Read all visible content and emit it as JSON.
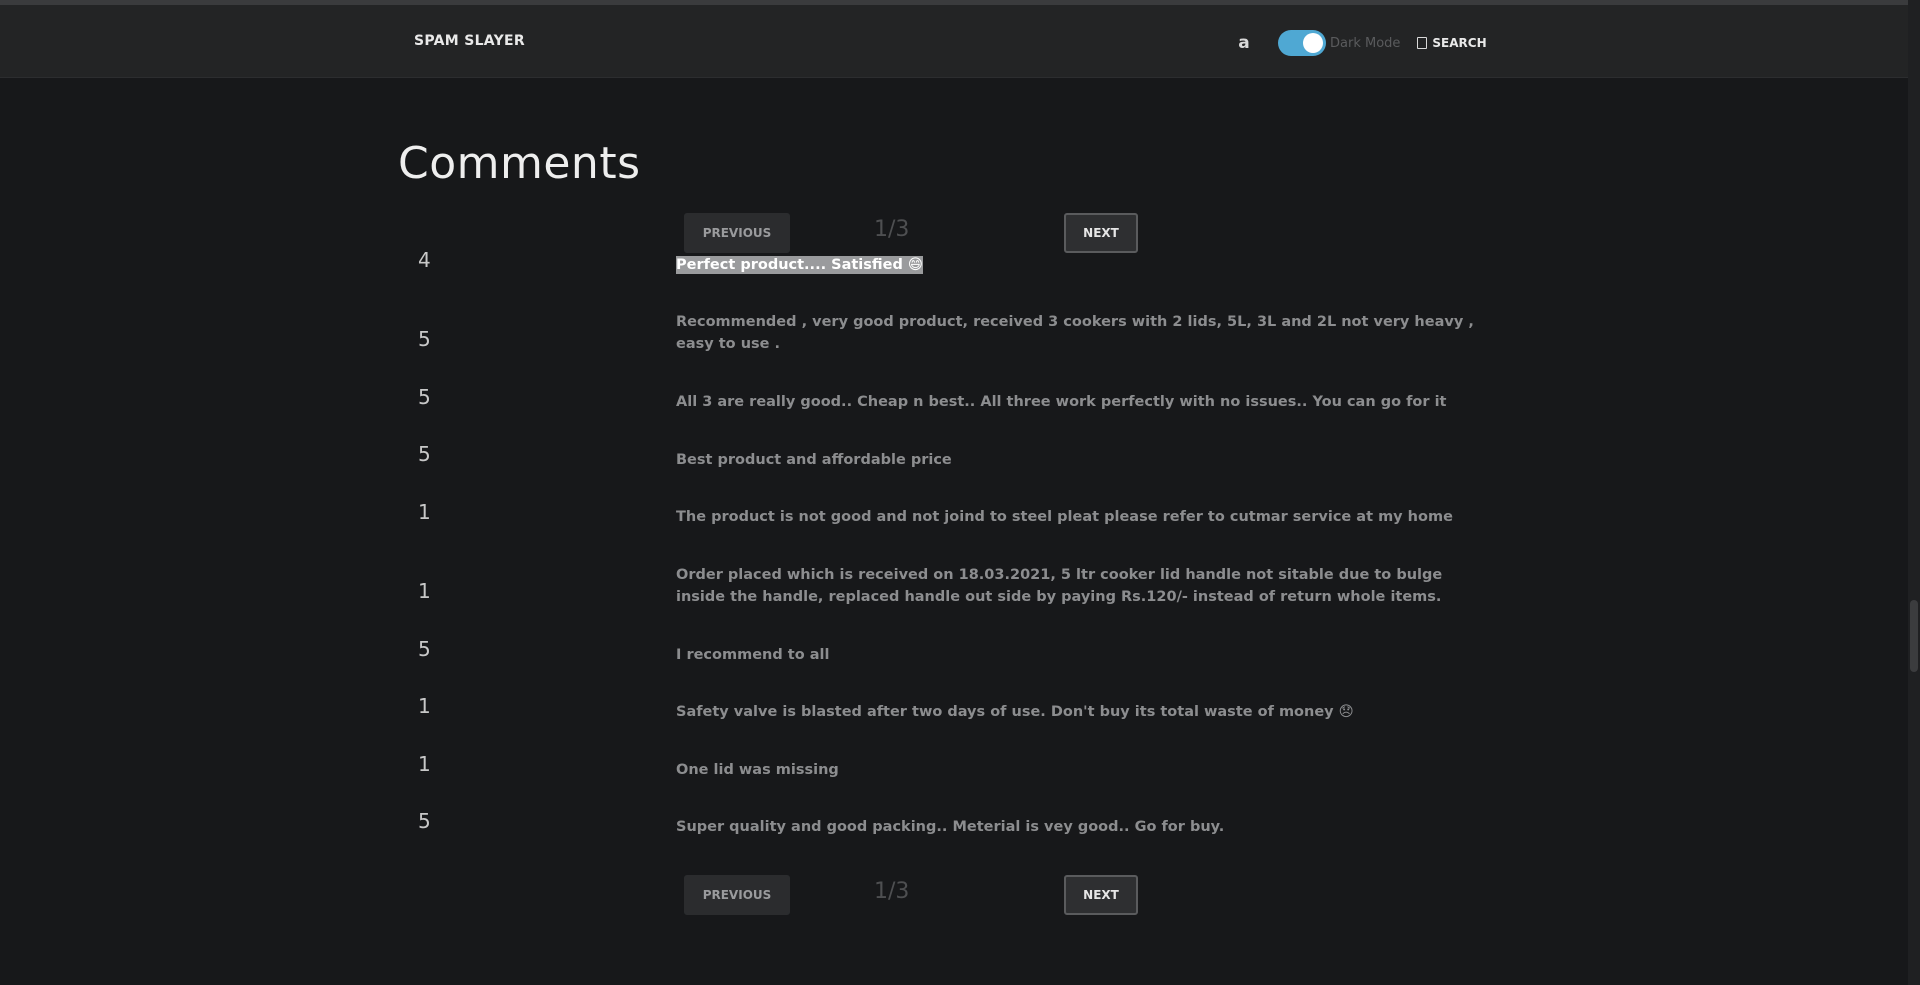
{
  "header": {
    "brand": "SPAM SLAYER",
    "amazon_icon": "amazon-icon",
    "dark_mode_label": "Dark Mode",
    "dark_mode_on": true,
    "search_label": "SEARCH",
    "accent_color": "#4fa8d3"
  },
  "page": {
    "title": "Comments"
  },
  "pager": {
    "previous_label": "PREVIOUS",
    "page_indicator": "1/3",
    "next_label": "NEXT"
  },
  "comments": [
    {
      "rating": "4",
      "text": "Perfect product.... Satisfied 😄",
      "selected": true
    },
    {
      "rating": "5",
      "text": "Recommended , very good product, received 3 cookers with 2 lids, 5L, 3L and 2L not very heavy , easy to use ."
    },
    {
      "rating": "5",
      "text": "All 3 are really good.. Cheap n best.. All three work perfectly with no issues.. You can go for it"
    },
    {
      "rating": "5",
      "text": "Best product and affordable price"
    },
    {
      "rating": "1",
      "text": "The product is not good and not joind to steel pleat please refer to cutmar service at my home"
    },
    {
      "rating": "1",
      "text": "Order placed which is received on 18.03.2021, 5 ltr cooker lid handle not sitable due to bulge inside the handle, replaced handle out side by paying Rs.120/- instead of return whole items."
    },
    {
      "rating": "5",
      "text": "I recommend to all"
    },
    {
      "rating": "1",
      "text": " Safety valve is blasted after two days of use. Don't buy its total waste of money 😞"
    },
    {
      "rating": "1",
      "text": "One lid was missing"
    },
    {
      "rating": "5",
      "text": " Super quality and good packing.. Meterial is vey good.. Go for buy."
    }
  ]
}
